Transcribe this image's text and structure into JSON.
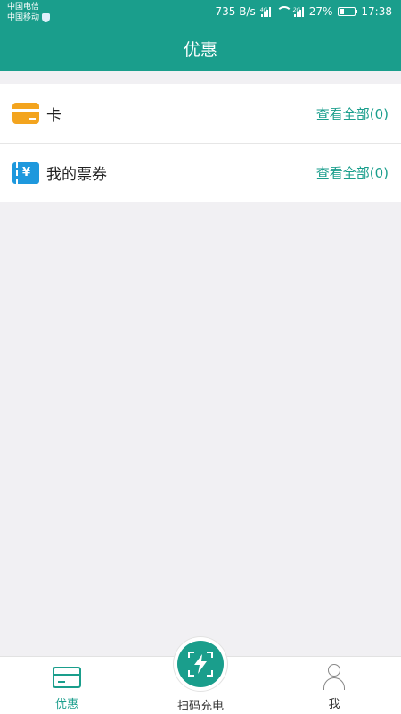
{
  "colors": {
    "brand": "#1a9e8c",
    "card_icon": "#f3a41e",
    "ticket_icon": "#1e98dd"
  },
  "status_bar": {
    "carrier_1": "中国电信",
    "carrier_2": "中国移动",
    "speed": "735 B/s",
    "network_tag_1": "4G",
    "network_tag_2": "2G",
    "battery": "27%",
    "time": "17:38",
    "battery_level": 0.27
  },
  "header": {
    "title": "优惠"
  },
  "list": [
    {
      "label": "卡",
      "link": "查看全部(0)",
      "icon": "card-icon"
    },
    {
      "label": "我的票券",
      "link": "查看全部(0)",
      "icon": "ticket-icon"
    }
  ],
  "ticket_symbol": "¥",
  "nav": {
    "offers": "优惠",
    "scan": "扫码充电",
    "me": "我"
  }
}
